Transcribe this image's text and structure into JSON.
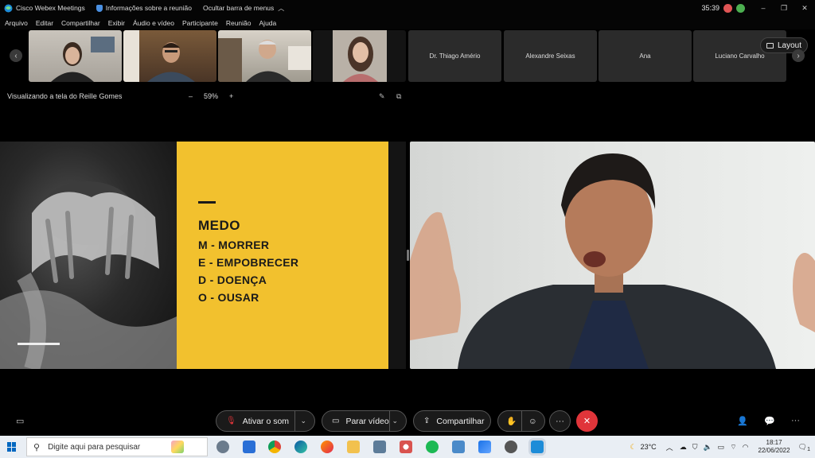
{
  "titlebar": {
    "app_title": "Cisco Webex Meetings",
    "meeting_info": "Informações sobre a reunião",
    "hide_menu": "Ocultar barra de menus",
    "timer": "35:39",
    "avatar1": "",
    "avatar2": "",
    "minimize": "–",
    "restore": "❐",
    "close": "✕"
  },
  "menu": [
    "Arquivo",
    "Editar",
    "Compartilhar",
    "Exibir",
    "Áudio e vídeo",
    "Participante",
    "Reunião",
    "Ajuda"
  ],
  "strip": {
    "prev": "‹",
    "next": "›",
    "name_tiles": [
      "Dr. Thiago Amério",
      "Alexandre Seixas",
      "Ana",
      "Luciano Carvalho"
    ],
    "layout_label": "Layout"
  },
  "share": {
    "title": "Visualizando a tela do Reille Gomes",
    "zoom_minus": "–",
    "zoom_value": "59%",
    "zoom_plus": "+"
  },
  "slide": {
    "title": "MEDO",
    "lines": [
      "M - MORRER",
      "E - EMPOBRECER",
      "D - DOENÇA",
      "O - OUSAR"
    ],
    "colors": {
      "yellow": "#f2c12e",
      "text": "#1a1a1a"
    }
  },
  "toolbar": {
    "mute_label": "Ativar o som",
    "video_label": "Parar vídeo",
    "share_label": "Compartilhar",
    "more": "···",
    "end": "✕"
  },
  "taskbar": {
    "search_placeholder": "Digite aqui para pesquisar",
    "weather": "23°C",
    "time": "18:17",
    "date": "22/06/2022",
    "notifications": "1"
  },
  "colors": {
    "end_call": "#e0353a",
    "accent_blue": "#0067c0"
  }
}
